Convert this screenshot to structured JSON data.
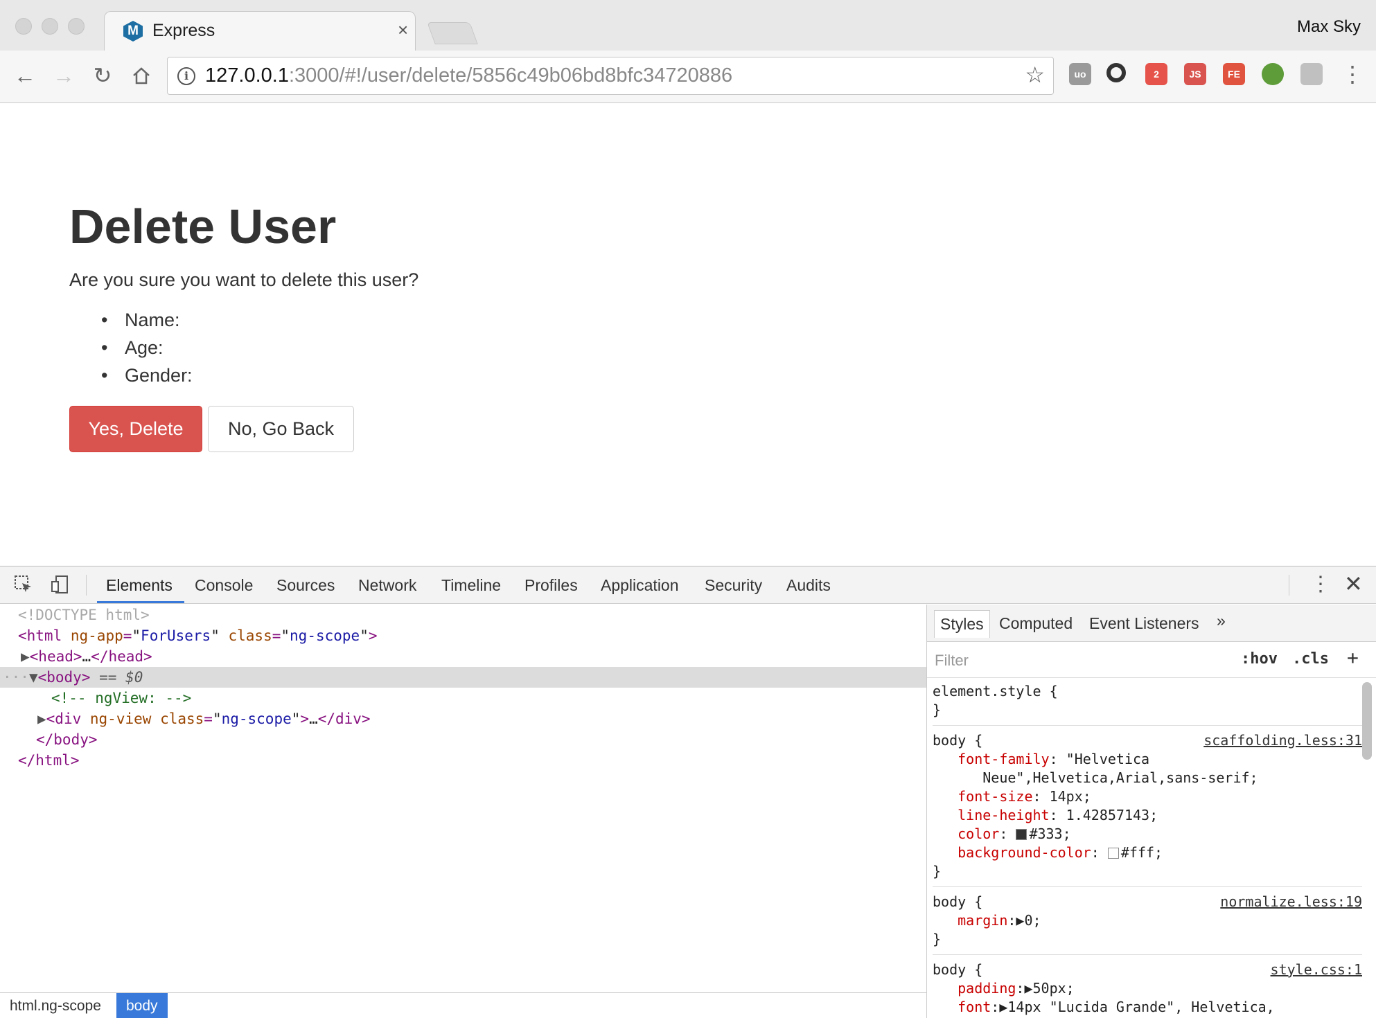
{
  "browser": {
    "tab_title": "Express",
    "tab_favicon": "M",
    "tab_close": "×",
    "profile_name": "Max Sky",
    "url_host": "127.0.0.1",
    "url_rest": ":3000/#!/user/delete/5856c49b06bd8bfc34720886",
    "extensions": [
      {
        "name": "ublock-icon",
        "label": "uo",
        "color": "#9a9a9a"
      },
      {
        "name": "circle-extension-icon",
        "label": "",
        "color": "#333333"
      },
      {
        "name": "chat-extension-icon",
        "label": "2",
        "color": "#e5534b"
      },
      {
        "name": "js-extension-icon",
        "label": "JS",
        "color": "#d9534f"
      },
      {
        "name": "fe-extension-icon",
        "label": "FE",
        "color": "#e0533f"
      },
      {
        "name": "globe-extension-icon",
        "label": "",
        "color": "#5d9c39"
      },
      {
        "name": "android-extension-icon",
        "label": "",
        "color": "#c0c0c0"
      }
    ]
  },
  "page": {
    "heading": "Delete User",
    "lead": "Are you sure you want to delete this user?",
    "fields": [
      "Name:",
      "Age:",
      "Gender:"
    ],
    "confirm_button": "Yes, Delete",
    "cancel_button": "No, Go Back"
  },
  "devtools": {
    "tabs": [
      "Elements",
      "Console",
      "Sources",
      "Network",
      "Timeline",
      "Profiles",
      "Application",
      "Security",
      "Audits"
    ],
    "active_tab": "Elements",
    "breadcrumbs": [
      "html.ng-scope",
      "body"
    ],
    "styles_tabs": [
      "Styles",
      "Computed",
      "Event Listeners"
    ],
    "filter_placeholder": "Filter",
    "filter_hov": ":hov",
    "filter_cls": ".cls",
    "filter_add": "+"
  },
  "colors": {
    "danger": "#d9534f",
    "accent": "#3879d9"
  }
}
